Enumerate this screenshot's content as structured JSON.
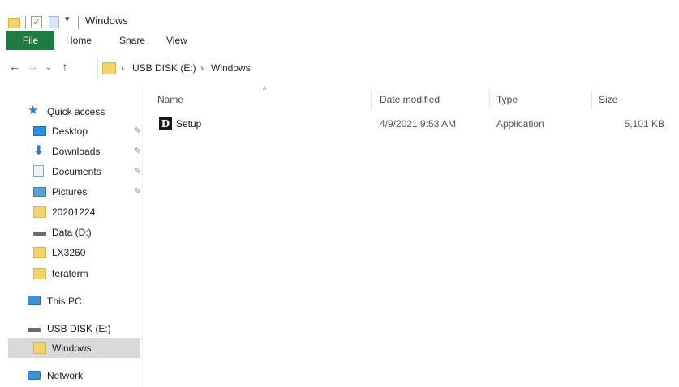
{
  "window": {
    "title": "Windows",
    "quick_access_arrow": "▾"
  },
  "ribbon": {
    "tabs": [
      "File",
      "Home",
      "Share",
      "View"
    ]
  },
  "address": {
    "path": [
      "USB DISK (E:)",
      "Windows"
    ],
    "separator": "›"
  },
  "navpane": {
    "items": [
      {
        "label": "Quick access",
        "icon": "star-icon"
      },
      {
        "label": "Desktop",
        "icon": "desktop-icon",
        "pinned": true
      },
      {
        "label": "Downloads",
        "icon": "download-arrow-icon",
        "pinned": true
      },
      {
        "label": "Documents",
        "icon": "documents-icon",
        "pinned": true
      },
      {
        "label": "Pictures",
        "icon": "pictures-icon",
        "pinned": true
      },
      {
        "label": "20201224",
        "icon": "folder-icon"
      },
      {
        "label": "Data (D:)",
        "icon": "drive-icon"
      },
      {
        "label": "LX3260",
        "icon": "folder-icon"
      },
      {
        "label": "teraterm",
        "icon": "folder-icon"
      },
      {
        "label": "This PC",
        "icon": "computer-icon"
      },
      {
        "label": "USB DISK (E:)",
        "icon": "drive-icon"
      },
      {
        "label": "Windows",
        "icon": "folder-icon",
        "selected": true
      },
      {
        "label": "Network",
        "icon": "network-icon"
      }
    ]
  },
  "filelist": {
    "columns": [
      "Name",
      "Date modified",
      "Type",
      "Size"
    ],
    "sorted_by": "Name",
    "rows": [
      {
        "name": "Setup",
        "date_modified": "4/9/2021 9:53 AM",
        "type": "Application",
        "size": "5,101 KB",
        "icon_glyph": "D"
      }
    ]
  },
  "colors": {
    "file_tab": "#1f7b3e",
    "selected_item": "#d9d9d9",
    "folder": "#f3d36b"
  }
}
